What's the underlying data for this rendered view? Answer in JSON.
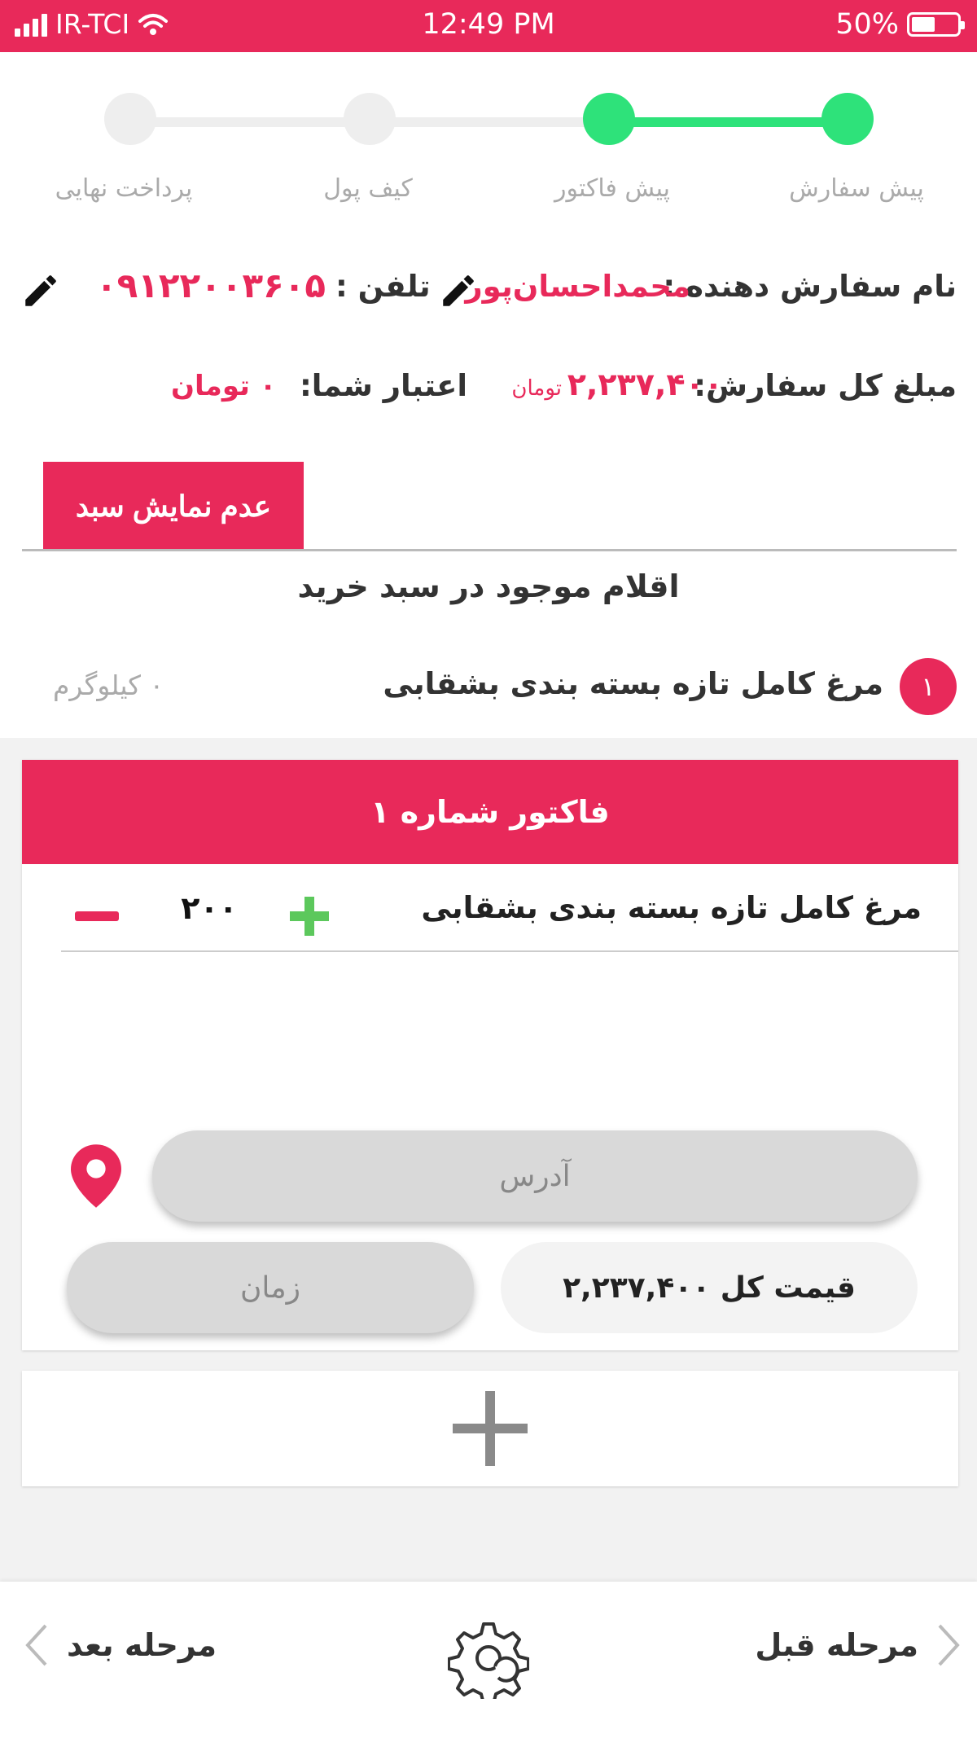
{
  "status_bar": {
    "carrier": "IR-TCI",
    "time": "12:49  PM",
    "battery": "50%"
  },
  "stepper": {
    "steps": [
      {
        "label": "پیش سفارش",
        "state": "done"
      },
      {
        "label": "پیش فاکتور",
        "state": "done"
      },
      {
        "label": "کیف پول",
        "state": "pending"
      },
      {
        "label": "پرداخت نهایی",
        "state": "pending"
      }
    ],
    "active_color": "#2ee27a",
    "inactive_color": "#eeeeee"
  },
  "order_info": {
    "customer_label": "نام سفارش دهنده :",
    "customer_name": "محمداحسان‌پور",
    "phone_label": "تلفن :",
    "phone": "۰۹۱۲۲۰۰۳۶۰۵",
    "total_label": "مبلغ کل سفارش:",
    "total_value": "۲,۲۳۷,۴۰۰",
    "total_unit": "تومان",
    "credit_label": "اعتبار شما:",
    "credit_value": "۰ تومان"
  },
  "hide_cart_button": "عدم نمایش سبد",
  "cart": {
    "title": "اقلام موجود در سبد خرید",
    "items": [
      {
        "index": "۱",
        "name": "مرغ کامل تازه بسته بندی بشقابی",
        "qty": "۰ کیلوگرم"
      }
    ]
  },
  "invoice": {
    "title": "فاکتور شماره ۱",
    "line": {
      "name": "مرغ کامل تازه بسته بندی بشقابی",
      "qty": "۲۰۰"
    },
    "address_placeholder": "آدرس",
    "time_placeholder": "زمان",
    "total_label": "قیمت کل ۲,۲۳۷,۴۰۰"
  },
  "bottom_nav": {
    "prev": "مرحله قبل",
    "next": "مرحله بعد"
  },
  "colors": {
    "brand": "#e8295a",
    "success": "#2ee27a",
    "plus": "#5cc85c"
  }
}
